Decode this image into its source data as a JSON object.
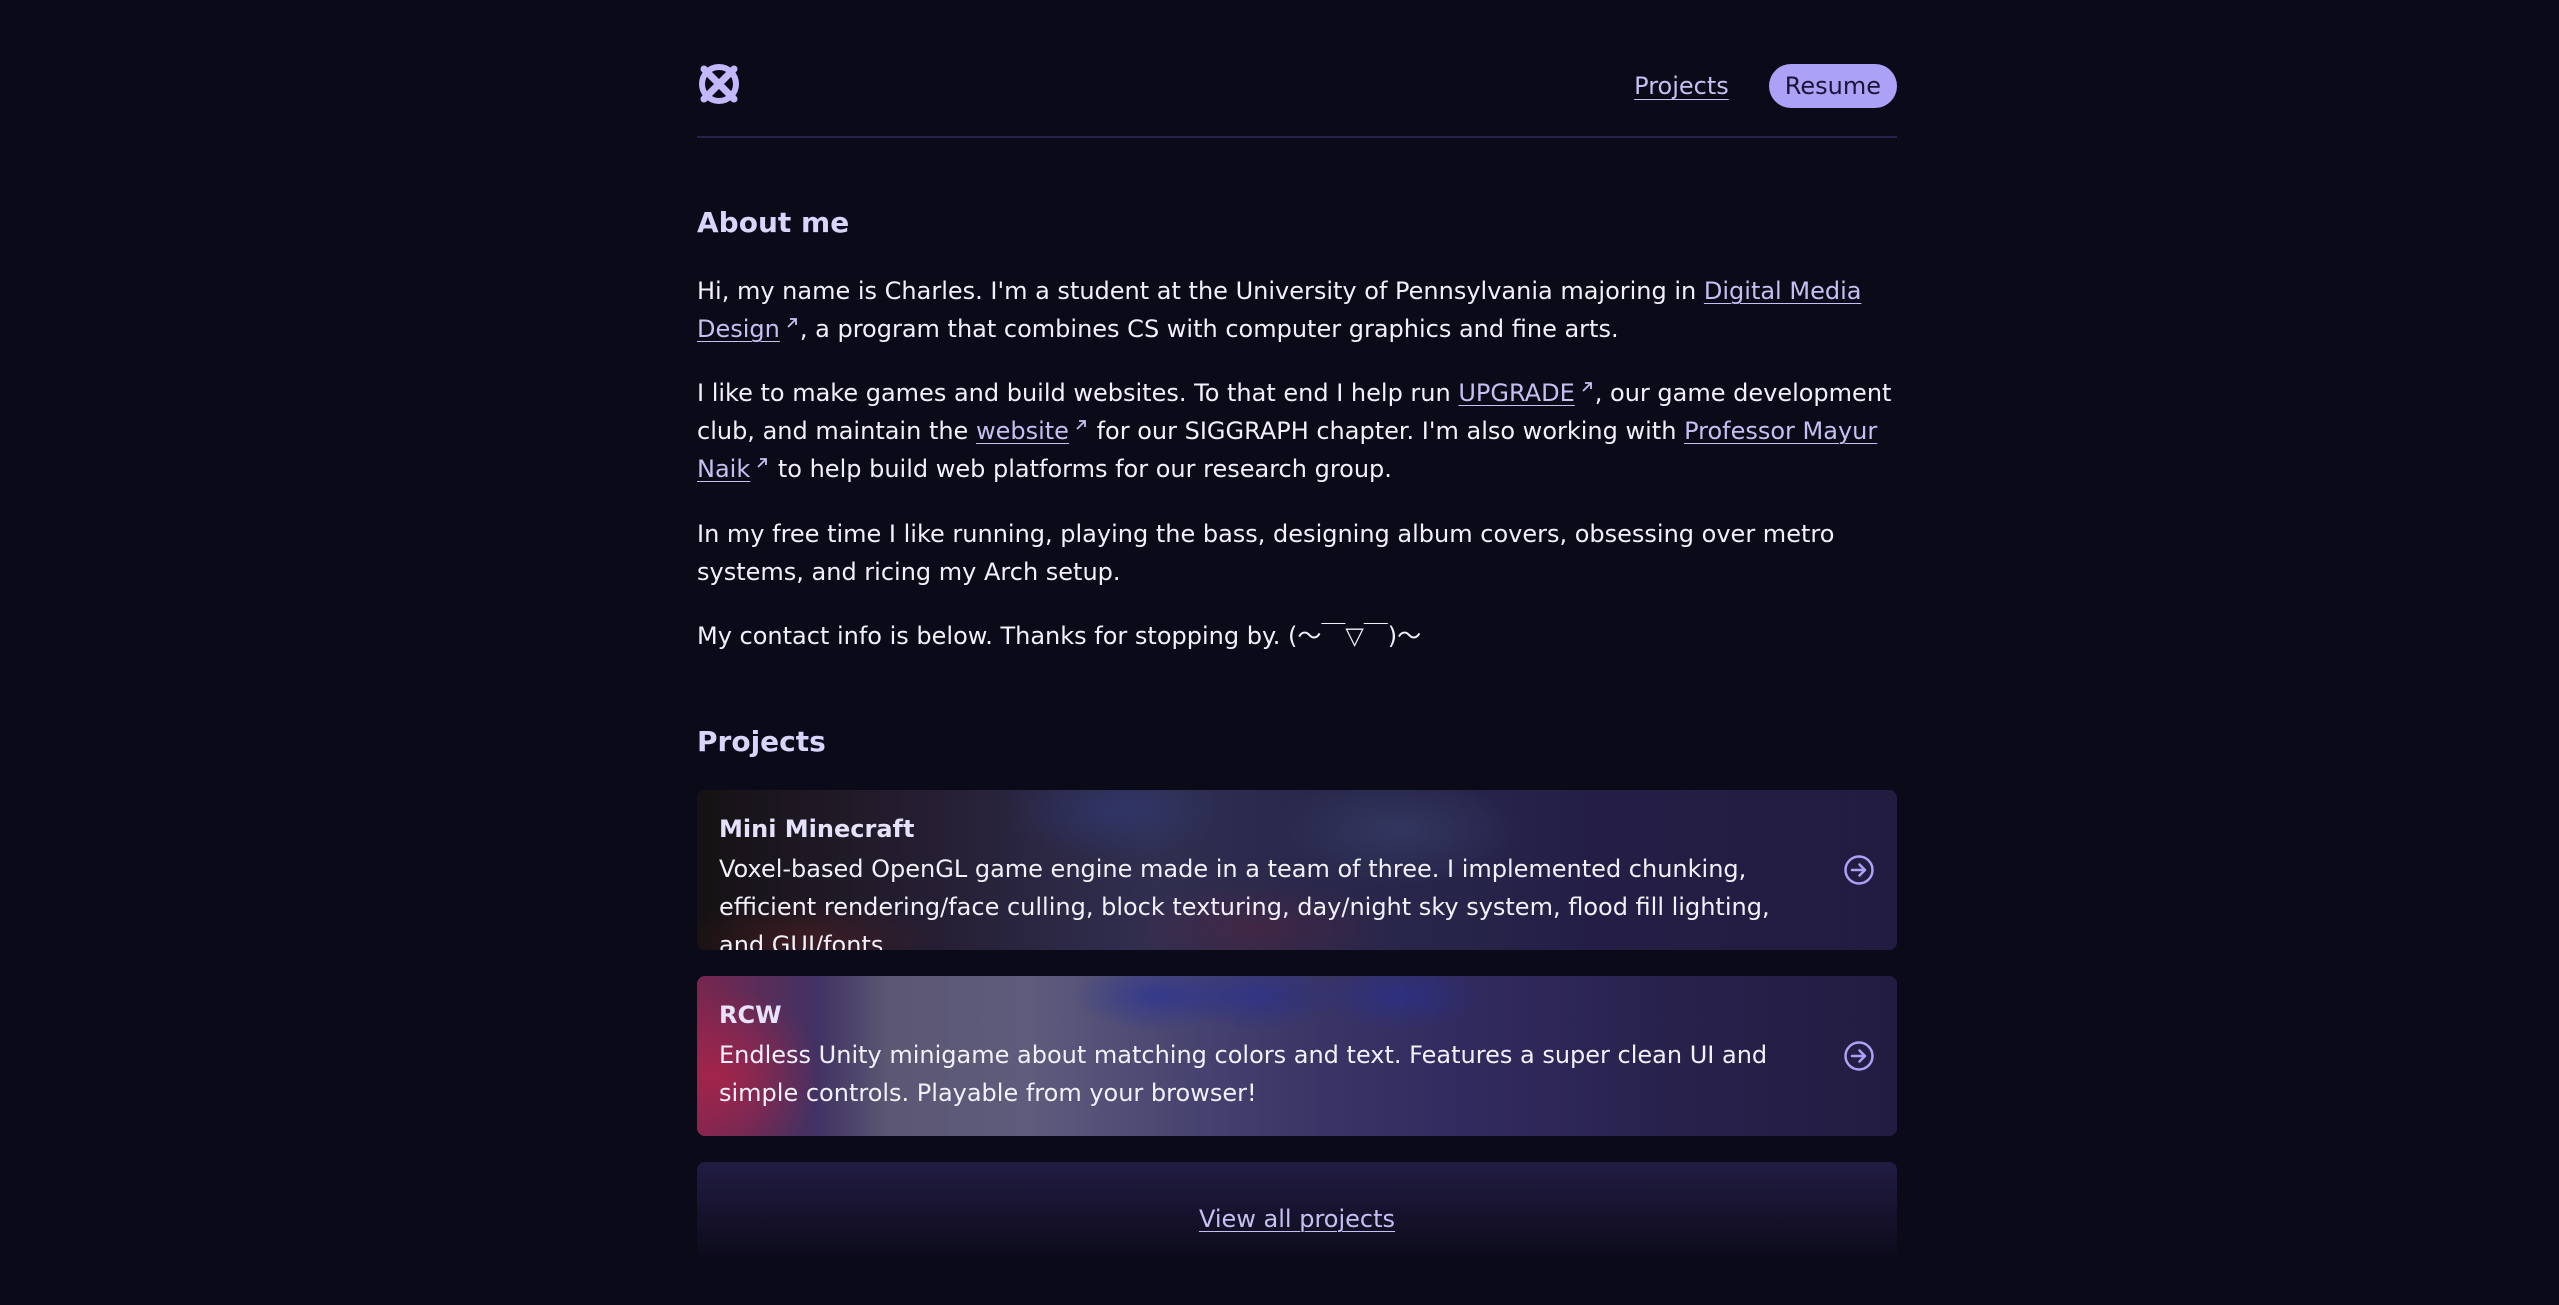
{
  "nav": {
    "projects_label": "Projects",
    "resume_label": "Resume"
  },
  "about": {
    "title": "About me",
    "p1_before": "Hi, my name is Charles. I'm a student at the University of Pennsylvania majoring in ",
    "p1_link": "Digital Media Design",
    "p1_after": ", a program that combines CS with computer graphics and fine arts.",
    "p2_a": "I like to make games and build websites. To that end I help run ",
    "p2_link1": "UPGRADE",
    "p2_b": ", our game development club, and maintain the ",
    "p2_link2": "website",
    "p2_c": " for our SIGGRAPH chapter. I'm also working with ",
    "p2_link3": "Professor Mayur Naik",
    "p2_d": " to help build web platforms for our research group.",
    "p3": "In my free time I like running, playing the bass, designing album covers, obsessing over metro systems, and ricing my Arch setup.",
    "p4": "My contact info is below. Thanks for stopping by. (〜￣▽￣)〜"
  },
  "projects": {
    "title": "Projects",
    "items": [
      {
        "title": "Mini Minecraft",
        "description": "Voxel-based OpenGL game engine made in a team of three. I implemented chunking, efficient rendering/face culling, block texturing, day/night sky system, flood fill lighting, and GUI/fonts."
      },
      {
        "title": "RCW",
        "description": "Endless Unity minigame about matching colors and text. Features a super clean UI and simple controls. Playable from your browser!"
      }
    ],
    "view_all_label": "View all projects"
  },
  "colors": {
    "background": "#0b0a19",
    "accent": "#aba1f7",
    "link": "#c5c0f2",
    "heading": "#d8d4fb"
  },
  "icons": {
    "logo": "crossed-circle-logo-icon",
    "external": "arrow-up-right-icon",
    "card_arrow": "circle-arrow-right-icon"
  }
}
